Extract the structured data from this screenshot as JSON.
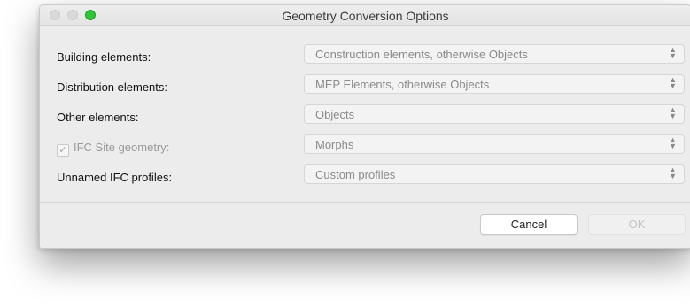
{
  "window": {
    "title": "Geometry Conversion Options"
  },
  "rows": [
    {
      "label": "Building elements:",
      "value": "Construction elements, otherwise Objects"
    },
    {
      "label": "Distribution elements:",
      "value": "MEP Elements, otherwise Objects"
    },
    {
      "label": "Other elements:",
      "value": "Objects"
    },
    {
      "label": "IFC Site geometry:",
      "value": "Morphs",
      "checked": true,
      "disabled": true
    },
    {
      "label": "Unnamed IFC profiles:",
      "value": "Custom profiles"
    }
  ],
  "buttons": {
    "cancel": "Cancel",
    "ok": "OK"
  },
  "icons": {
    "popup_arrows": "up-down-chevron-icon",
    "checkmark": "checkmark-icon"
  },
  "colors": {
    "zoom_button": "#2fc23a"
  }
}
